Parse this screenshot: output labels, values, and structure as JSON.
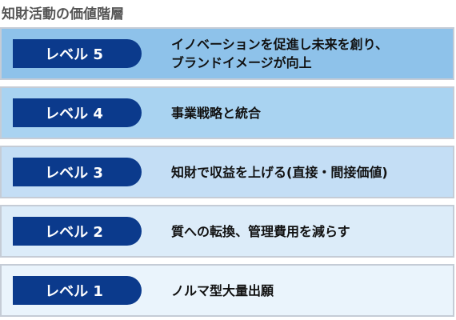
{
  "title": "知財活動の価値階層",
  "levels": [
    {
      "id": "5",
      "label": "レベル 5",
      "description": "イノベーションを促進し未来を創り、\nブランドイメージが向上",
      "color": "#8ec2ea"
    },
    {
      "id": "4",
      "label": "レベル 4",
      "description": "事業戦略と統合",
      "color": "#a9d3f1"
    },
    {
      "id": "3",
      "label": "レベル 3",
      "description": "知財で収益を上げる(直接・間接価値)",
      "color": "#c4def5"
    },
    {
      "id": "2",
      "label": "レベル 2",
      "description": "質への転換、管理費用を減らす",
      "color": "#dcecf9"
    },
    {
      "id": "1",
      "label": "レベル 1",
      "description": "ノルマ型大量出願",
      "color": "#eaf4fc"
    }
  ],
  "badge_color": "#0b3a8c"
}
